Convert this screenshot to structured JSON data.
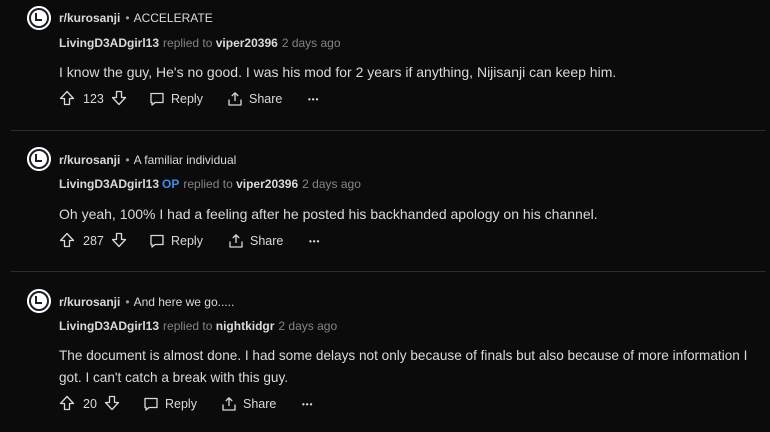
{
  "comments": [
    {
      "subreddit": "r/kurosanji",
      "separator": "•",
      "post_title": "ACCELERATE",
      "author": "LivingD3ADgirl13",
      "op_badge": "",
      "replied_to_label": "replied to",
      "replied_to": "viper20396",
      "age": "2 days ago",
      "body": "I know the guy, He's no good. I was his mod for 2 years if anything, Nijisanji can keep him.",
      "score": "123",
      "reply_label": "Reply",
      "share_label": "Share",
      "more_label": "•••"
    },
    {
      "subreddit": "r/kurosanji",
      "separator": "•",
      "post_title": "A familiar individual",
      "author": "LivingD3ADgirl13",
      "op_badge": "OP",
      "replied_to_label": "replied to",
      "replied_to": "viper20396",
      "age": "2 days ago",
      "body": "Oh yeah, 100% I had a feeling after he posted his backhanded apology on his channel.",
      "score": "287",
      "reply_label": "Reply",
      "share_label": "Share",
      "more_label": "•••"
    },
    {
      "subreddit": "r/kurosanji",
      "separator": "•",
      "post_title": "And here we go.....",
      "author": "LivingD3ADgirl13",
      "op_badge": "",
      "replied_to_label": "replied to",
      "replied_to": "nightkidgr",
      "age": "2 days ago",
      "body": "The document is almost done. I had some delays not only because of finals but also because of more information I got. I can't catch a break with this guy.",
      "score": "20",
      "reply_label": "Reply",
      "share_label": "Share",
      "more_label": "•••"
    }
  ],
  "colors": {
    "background": "#0b0b0c",
    "text": "#d7dadc",
    "muted": "#828589",
    "op": "#3a8fe8",
    "divider": "#2a2c2e"
  },
  "icons": [
    "subreddit-avatar-icon",
    "upvote-icon",
    "downvote-icon",
    "reply-bubble-icon",
    "share-icon"
  ]
}
